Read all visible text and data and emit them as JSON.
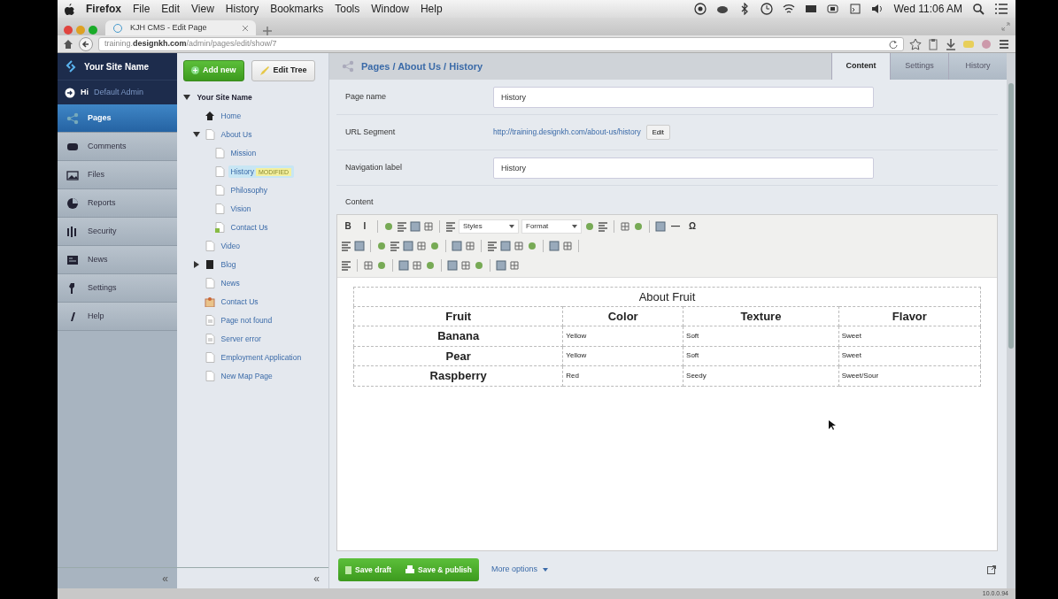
{
  "menubar": {
    "app": "Firefox",
    "menus": [
      "File",
      "Edit",
      "View",
      "History",
      "Bookmarks",
      "Tools",
      "Window",
      "Help"
    ],
    "clock": "Wed 11:06 AM"
  },
  "browser": {
    "tab_title": "KJH CMS - Edit Page",
    "url": "training.**designkh.com**/admin/pages/edit/show/7"
  },
  "sidebar": {
    "brand": "Your Site Name",
    "greeting": "Hi",
    "user": "Default Admin",
    "items": [
      {
        "label": "Pages",
        "selected": true
      },
      {
        "label": "Comments",
        "selected": false
      },
      {
        "label": "Files",
        "selected": false
      },
      {
        "label": "Reports",
        "selected": false
      },
      {
        "label": "Security",
        "selected": false
      },
      {
        "label": "News",
        "selected": false
      },
      {
        "label": "Settings",
        "selected": false
      },
      {
        "label": "Help",
        "selected": false
      }
    ],
    "collapse": "«"
  },
  "tree_panel": {
    "add_button": "Add new",
    "edit_button": "Edit Tree",
    "collapse": "«",
    "tree": [
      {
        "label": "Your Site Name",
        "kind": "root",
        "selected": false,
        "expanded": true,
        "children": [
          {
            "label": "Home",
            "kind": "home",
            "selected": false
          },
          {
            "label": "About Us",
            "kind": "page",
            "selected": false,
            "expanded": true,
            "children": [
              {
                "label": "Mission",
                "kind": "page",
                "selected": false
              },
              {
                "label": "History",
                "kind": "page",
                "selected": true,
                "badge": "MODIFIED"
              },
              {
                "label": "Philosophy",
                "kind": "page",
                "selected": false
              },
              {
                "label": "Vision",
                "kind": "page",
                "selected": false
              },
              {
                "label": "Contact Us",
                "kind": "form",
                "selected": false
              }
            ]
          },
          {
            "label": "Video",
            "kind": "page",
            "selected": false
          },
          {
            "label": "Blog",
            "kind": "blog",
            "selected": false,
            "expanded": false
          },
          {
            "label": "News",
            "kind": "page",
            "selected": false
          },
          {
            "label": "Contact Us",
            "kind": "contact",
            "selected": false
          },
          {
            "label": "Page not found",
            "kind": "error",
            "selected": false
          },
          {
            "label": "Server error",
            "kind": "error",
            "selected": false
          },
          {
            "label": "Employment Application",
            "kind": "page",
            "selected": false
          },
          {
            "label": "New Map Page",
            "kind": "page",
            "selected": false
          }
        ]
      }
    ]
  },
  "header": {
    "breadcrumb": "Pages / About Us / History",
    "tabs": [
      {
        "label": "Content",
        "selected": true
      },
      {
        "label": "Settings",
        "selected": false
      },
      {
        "label": "History",
        "selected": false
      }
    ]
  },
  "form": {
    "fields": [
      {
        "kind": "input",
        "label": "Page name",
        "value": "History"
      },
      {
        "kind": "link",
        "label": "URL Segment",
        "value": "http://training.designkh.com/about-us/history",
        "button": "Edit"
      },
      {
        "kind": "input",
        "label": "Navigation label",
        "value": "History"
      }
    ],
    "content_label": "Content"
  },
  "editor": {
    "toolbar": [
      [
        {
          "kind": "glyph",
          "text": "B"
        },
        {
          "kind": "glyph",
          "text": "I"
        },
        {
          "kind": "sep"
        },
        {
          "kind": "icon"
        },
        {
          "kind": "icon"
        },
        {
          "kind": "icon"
        },
        {
          "kind": "icon"
        },
        {
          "kind": "sep"
        },
        {
          "kind": "icon"
        },
        {
          "kind": "select",
          "text": "Styles"
        },
        {
          "kind": "select",
          "text": "Format"
        },
        {
          "kind": "icon"
        },
        {
          "kind": "icon"
        },
        {
          "kind": "sep"
        },
        {
          "kind": "icon"
        },
        {
          "kind": "icon"
        },
        {
          "kind": "sep"
        },
        {
          "kind": "icon"
        },
        {
          "kind": "glyph",
          "text": "—"
        },
        {
          "kind": "glyph",
          "text": "Ω"
        }
      ],
      [
        {
          "kind": "icon"
        },
        {
          "kind": "icon"
        },
        {
          "kind": "sep"
        },
        {
          "kind": "icon"
        },
        {
          "kind": "icon"
        },
        {
          "kind": "icon"
        },
        {
          "kind": "icon"
        },
        {
          "kind": "icon"
        },
        {
          "kind": "sep"
        },
        {
          "kind": "icon"
        },
        {
          "kind": "icon"
        },
        {
          "kind": "sep"
        },
        {
          "kind": "icon"
        },
        {
          "kind": "icon"
        },
        {
          "kind": "icon"
        },
        {
          "kind": "icon"
        },
        {
          "kind": "sep"
        },
        {
          "kind": "icon"
        },
        {
          "kind": "icon"
        },
        {
          "kind": "sep"
        }
      ],
      [
        {
          "kind": "icon"
        },
        {
          "kind": "sep"
        },
        {
          "kind": "icon"
        },
        {
          "kind": "icon"
        },
        {
          "kind": "sep"
        },
        {
          "kind": "icon"
        },
        {
          "kind": "icon"
        },
        {
          "kind": "icon"
        },
        {
          "kind": "sep"
        },
        {
          "kind": "icon"
        },
        {
          "kind": "icon"
        },
        {
          "kind": "icon"
        },
        {
          "kind": "sep"
        },
        {
          "kind": "icon"
        },
        {
          "kind": "icon"
        }
      ]
    ],
    "table": {
      "caption": "About Fruit",
      "columns": [
        "Fruit",
        "Color",
        "Texture",
        "Flavor"
      ],
      "rows": [
        [
          "Banana",
          "Yellow",
          "Soft",
          "Sweet"
        ],
        [
          "Pear",
          "Yellow",
          "Soft",
          "Sweet"
        ],
        [
          "Raspberry",
          "Red",
          "Seedy",
          "Sweet/Sour"
        ]
      ]
    }
  },
  "footer": {
    "save_draft": "Save draft",
    "save_publish": "Save & publish",
    "more_options": "More options"
  },
  "status_bar": "10.0.0.94"
}
